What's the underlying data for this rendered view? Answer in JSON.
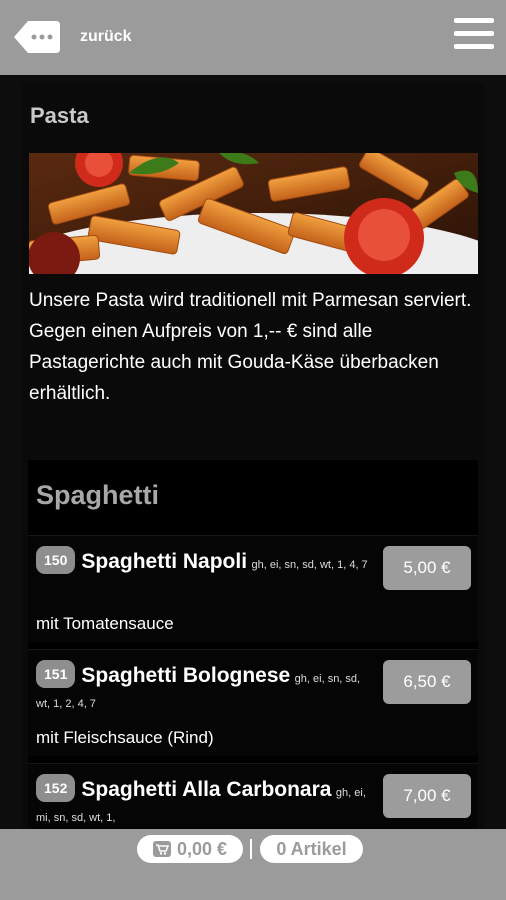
{
  "header": {
    "back_label": "zurück"
  },
  "section": {
    "title": "Pasta",
    "intro": "Unsere Pasta wird traditionell mit Parmesan serviert.\nGegen einen Aufpreis von 1,-- € sind alle Pastagerichte auch mit Gouda-Käse überbacken erhältlich."
  },
  "group": {
    "title": "Spaghetti",
    "items": [
      {
        "number": "150",
        "name": "Spaghetti Napoli",
        "allergens": "gh, ei, sn, sd, wt, 1, 4, 7",
        "description": "mit Tomatensauce",
        "price": "5,00 €"
      },
      {
        "number": "151",
        "name": "Spaghetti Bolognese",
        "allergens": "gh, ei, sn, sd, wt, 1, 2, 4, 7",
        "description": "mit Fleischsauce (Rind)",
        "price": "6,50 €"
      },
      {
        "number": "152",
        "name": "Spaghetti Alla Carbonara",
        "allergens": "gh, ei, mi, sn, sd, wt, 1,",
        "description": "",
        "price": "7,00 €"
      }
    ]
  },
  "cart": {
    "total": "0,00 €",
    "count": "0 Artikel"
  }
}
